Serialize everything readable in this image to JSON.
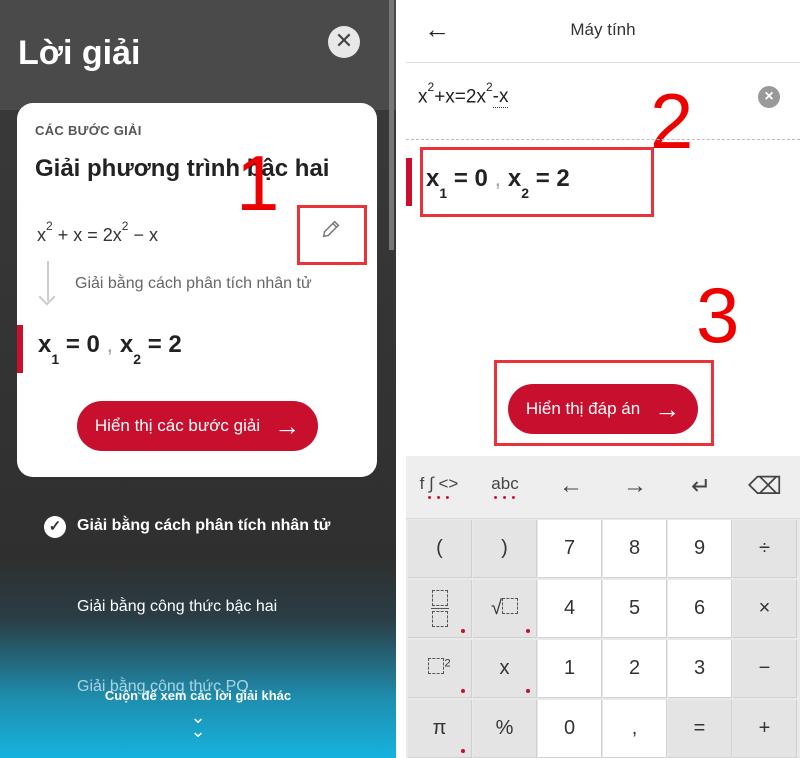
{
  "left": {
    "title": "Lời giải",
    "close_icon": "close-icon",
    "card": {
      "kicker": "CÁC BƯỚC GIẢI",
      "title": "Giải phương trình bậc hai",
      "equation": {
        "lhs": "x",
        "exp1": "2",
        "mid": "+ x = 2x",
        "exp2": "2",
        "rhs": "− x"
      },
      "method": "Giải bằng cách phân tích nhân tử",
      "result": {
        "v1": "x",
        "s1": "1",
        "e1": "= 0",
        "sep": ",",
        "v2": "x",
        "s2": "2",
        "e2": "= 2"
      },
      "button_label": "Hiển thị các bước giải"
    },
    "options": [
      "Giải bằng cách phân tích nhân tử",
      "Giải bằng công thức bậc hai",
      "Giải bằng công thức PQ"
    ],
    "scroll_hint": "Cuộn để xem các lời giải khác",
    "annotation": "1"
  },
  "right": {
    "title": "Máy tính",
    "input": {
      "a": "x",
      "e1": "2",
      "b": "+x=2x",
      "e2": "2",
      "c": "-x"
    },
    "result": {
      "v1": "x",
      "s1": "1",
      "e1": "= 0",
      "sep": ",",
      "v2": "x",
      "s2": "2",
      "e2": "= 2"
    },
    "button_label": "Hiển thị đáp án",
    "annotations": [
      "2",
      "3"
    ],
    "keyboard": {
      "tabs": [
        "f ∫ <>",
        "abc"
      ],
      "nav_icons": [
        "←",
        "→",
        "↵",
        "⌫"
      ],
      "rows": [
        [
          "(",
          ")",
          "7",
          "8",
          "9",
          "÷"
        ],
        [
          "frac",
          "sqrt",
          "4",
          "5",
          "6",
          "×"
        ],
        [
          "square",
          "x",
          "1",
          "2",
          "3",
          "−"
        ],
        [
          "π",
          "%",
          "0",
          ",",
          "=",
          "+"
        ]
      ]
    }
  },
  "colors": {
    "accent": "#c8102e",
    "annotation_red": "#e8333a"
  }
}
